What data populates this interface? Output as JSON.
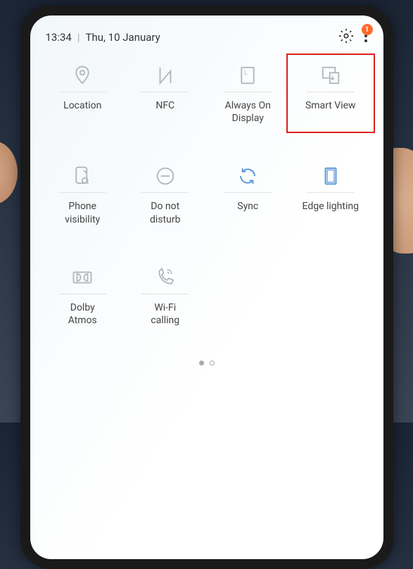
{
  "status": {
    "time": "13:34",
    "date": "Thu, 10 January",
    "badge_count": "1"
  },
  "tiles": [
    {
      "label": "Location"
    },
    {
      "label": "NFC"
    },
    {
      "label": "Always On\nDisplay"
    },
    {
      "label": "Smart View",
      "highlighted": true
    },
    {
      "label": "Phone\nvisibility"
    },
    {
      "label": "Do not\ndisturb"
    },
    {
      "label": "Sync"
    },
    {
      "label": "Edge lighting",
      "accent": true
    },
    {
      "label": "Dolby\nAtmos"
    },
    {
      "label": "Wi-Fi\ncalling"
    }
  ],
  "colors": {
    "icon_muted": "#b0b8bc",
    "icon_accent": "#5595d8",
    "highlight": "#d92020",
    "badge": "#ff6b2c"
  }
}
